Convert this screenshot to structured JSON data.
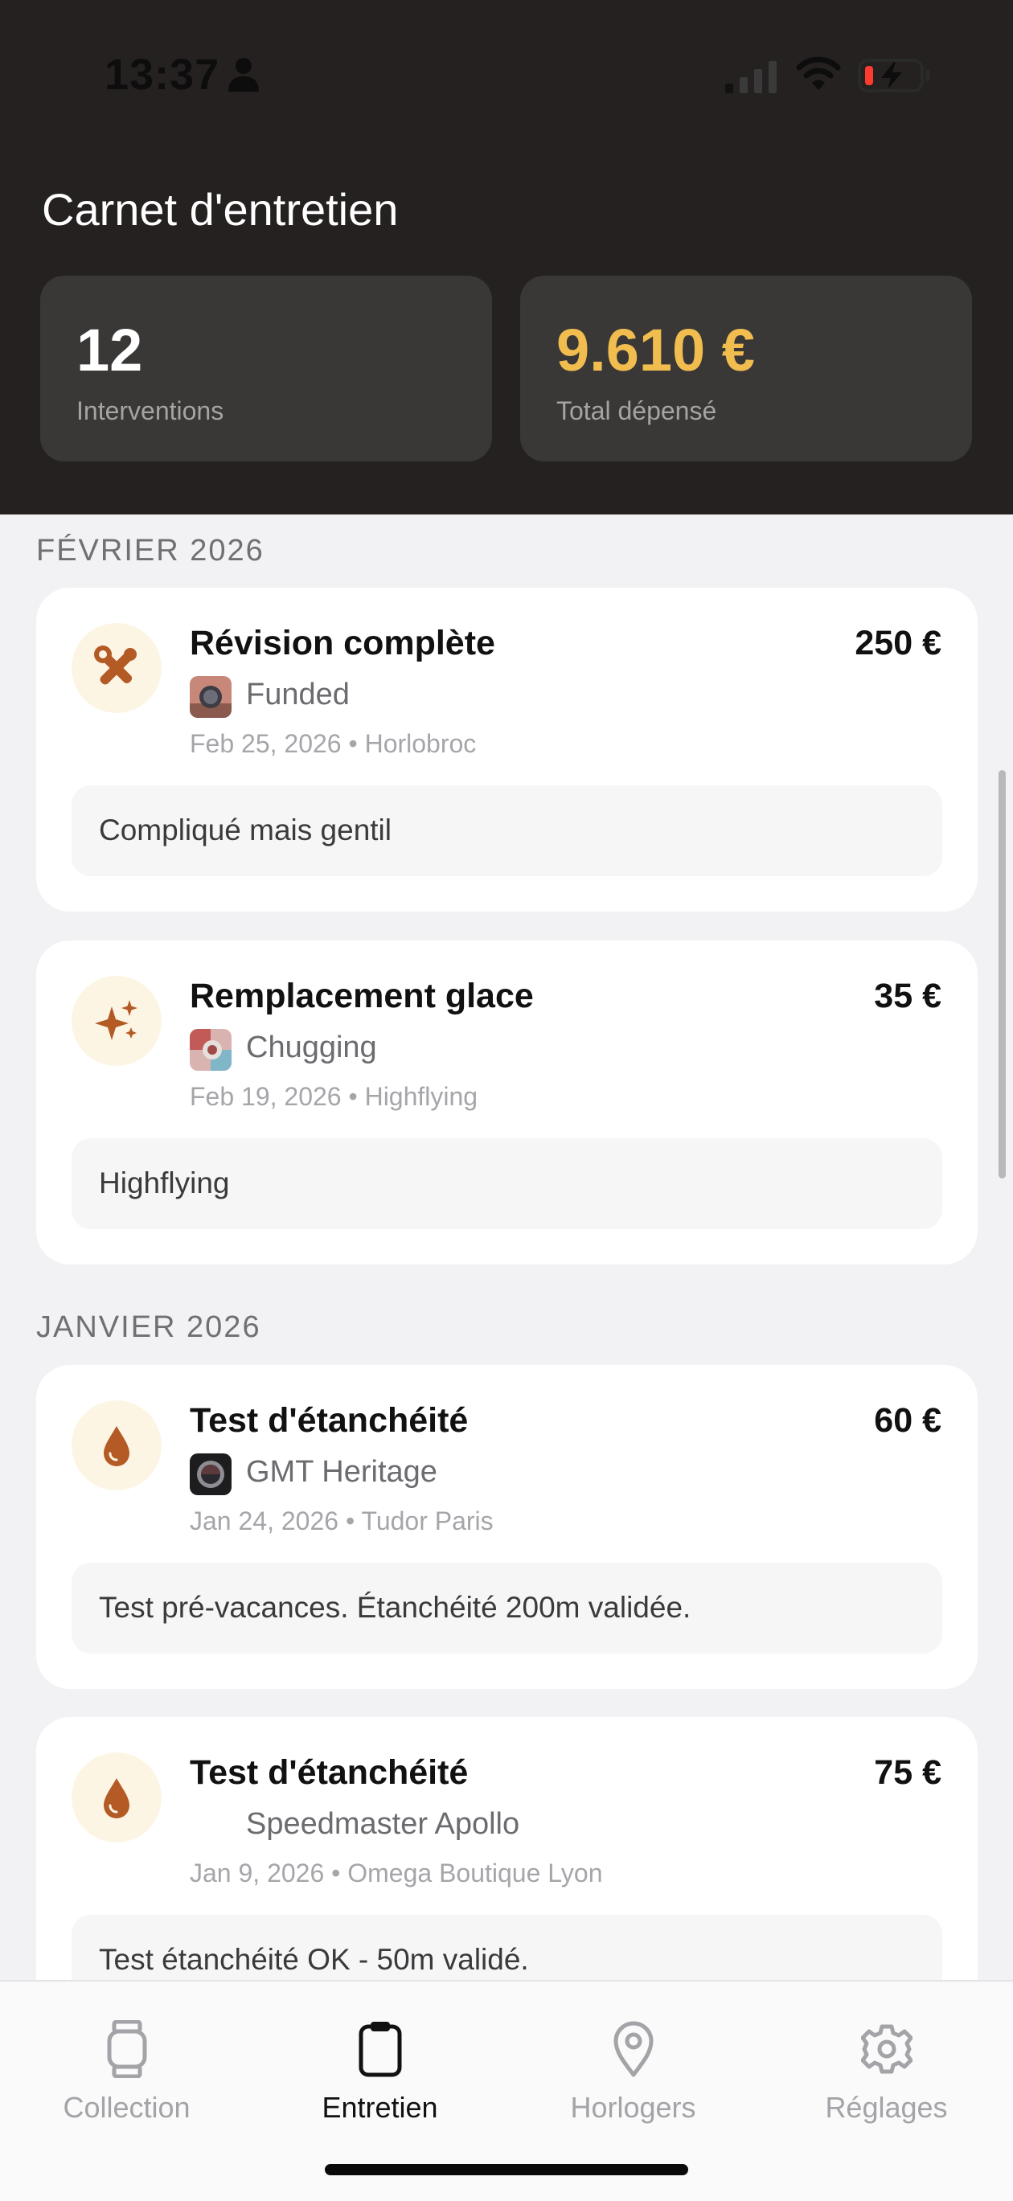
{
  "status_bar": {
    "time": "13:37"
  },
  "header": {
    "title": "Carnet d'entretien",
    "stats": [
      {
        "value": "12",
        "label": "Interventions"
      },
      {
        "value": "9.610 €",
        "label": "Total dépensé"
      }
    ]
  },
  "sections": [
    {
      "title": "FÉVRIER 2026",
      "entries": [
        {
          "icon": "tools-icon",
          "title": "Révision complète",
          "price": "250 €",
          "watch": "Funded",
          "meta": "Feb 25, 2026 • Horlobroc",
          "note": "Compliqué mais gentil"
        },
        {
          "icon": "sparkles-icon",
          "title": "Remplacement glace",
          "price": "35 €",
          "watch": "Chugging",
          "meta": "Feb 19, 2026 • Highflying",
          "note": "Highflying"
        }
      ]
    },
    {
      "title": "JANVIER 2026",
      "entries": [
        {
          "icon": "water-drop-icon",
          "title": "Test d'étanchéité",
          "price": "60 €",
          "watch": "GMT Heritage",
          "meta": "Jan 24, 2026 • Tudor Paris",
          "note": "Test pré-vacances. Étanchéité 200m validée."
        },
        {
          "icon": "water-drop-icon",
          "title": "Test d'étanchéité",
          "price": "75 €",
          "watch": "Speedmaster Apollo",
          "meta": "Jan 9, 2026 • Omega Boutique Lyon",
          "note": "Test étanchéité OK - 50m validé."
        }
      ]
    }
  ],
  "tabbar": {
    "tabs": [
      {
        "label": "Collection",
        "icon": "watch-icon",
        "active": false
      },
      {
        "label": "Entretien",
        "icon": "clipboard-icon",
        "active": true
      },
      {
        "label": "Horlogers",
        "icon": "map-pin-icon",
        "active": false
      },
      {
        "label": "Réglages",
        "icon": "gear-icon",
        "active": false
      }
    ]
  },
  "colors": {
    "header_bg": "#242120",
    "accent_gold": "#f0bd4e",
    "icon_brown": "#b35a25",
    "icon_bg": "#fdf5e4"
  }
}
